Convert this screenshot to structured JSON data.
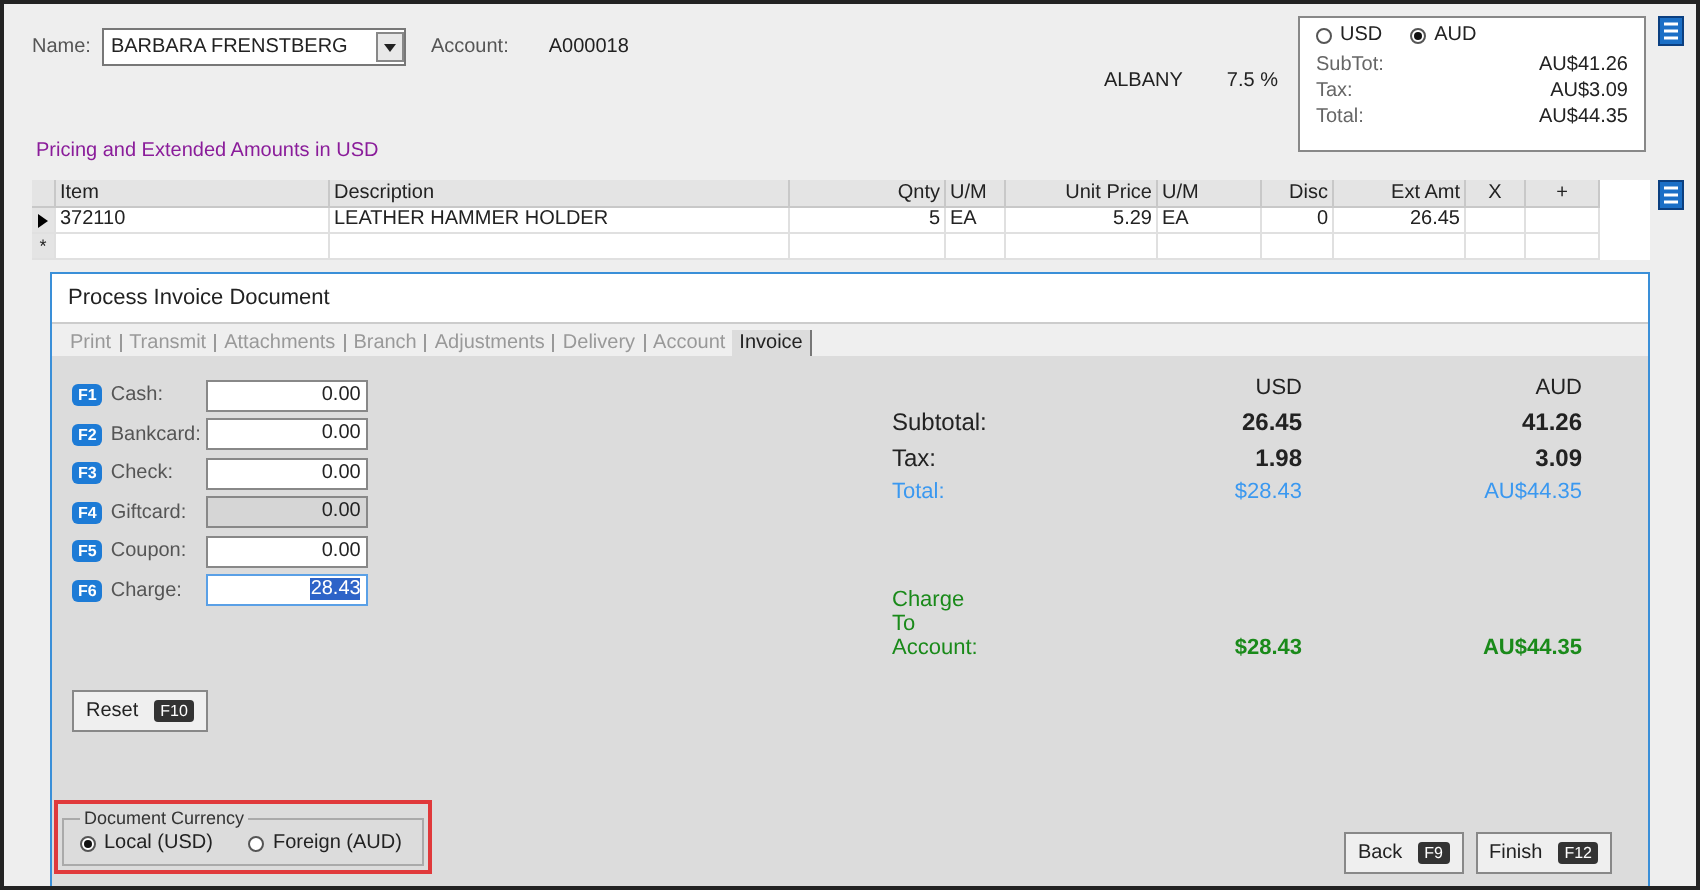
{
  "header": {
    "name_label": "Name:",
    "name_value": "BARBARA FRENSTBERG",
    "account_label": "Account:",
    "account_value": "A000018",
    "branch": "ALBANY",
    "tax_rate": "7.5 %"
  },
  "currency_box": {
    "options": [
      {
        "label": "USD",
        "selected": false
      },
      {
        "label": "AUD",
        "selected": true
      }
    ],
    "rows": [
      {
        "label": "SubTot:",
        "value": "AU$41.26"
      },
      {
        "label": "Tax:",
        "value": "AU$3.09"
      },
      {
        "label": "Total:",
        "value": "AU$44.35"
      }
    ]
  },
  "pricing_note": "Pricing and Extended Amounts in USD",
  "table": {
    "columns": [
      "Item",
      "Description",
      "Qnty",
      "U/M",
      "Unit Price",
      "U/M",
      "Disc",
      "Ext Amt",
      "X",
      "+"
    ],
    "rows": [
      {
        "selected": true,
        "cells": [
          "372110",
          "LEATHER HAMMER HOLDER",
          "5",
          "EA",
          "5.29",
          "EA",
          "0",
          "26.45",
          "",
          ""
        ]
      }
    ],
    "new_row_marker": "*"
  },
  "dialog": {
    "title": "Process Invoice Document",
    "tabs": [
      {
        "label": "Print",
        "selected": false
      },
      {
        "label": "Transmit",
        "selected": false
      },
      {
        "label": "Attachments",
        "selected": false
      },
      {
        "label": "Branch",
        "selected": false
      },
      {
        "label": "Adjustments",
        "selected": false
      },
      {
        "label": "Delivery",
        "selected": false
      },
      {
        "label": "Account",
        "selected": false
      },
      {
        "label": "Invoice",
        "selected": true
      }
    ],
    "payments": [
      {
        "key": "F1",
        "label": "Cash:",
        "value": "0.00",
        "disabled": false,
        "focused": false
      },
      {
        "key": "F2",
        "label": "Bankcard:",
        "value": "0.00",
        "disabled": false,
        "focused": false
      },
      {
        "key": "F3",
        "label": "Check:",
        "value": "0.00",
        "disabled": false,
        "focused": false
      },
      {
        "key": "F4",
        "label": "Giftcard:",
        "value": "0.00",
        "disabled": true,
        "focused": false
      },
      {
        "key": "F5",
        "label": "Coupon:",
        "value": "0.00",
        "disabled": false,
        "focused": false
      },
      {
        "key": "F6",
        "label": "Charge:",
        "value": "28.43",
        "disabled": false,
        "focused": true
      }
    ],
    "summary": {
      "headers": [
        "USD",
        "AUD"
      ],
      "rows": [
        {
          "kind": "plain",
          "label": "Subtotal:",
          "usd": "26.45",
          "aud": "41.26"
        },
        {
          "kind": "plain",
          "label": "Tax:",
          "usd": "1.98",
          "aud": "3.09"
        },
        {
          "kind": "total",
          "label": "Total:",
          "usd": "$28.43",
          "aud": "AU$44.35"
        },
        {
          "kind": "charge",
          "label": "Charge To Account:",
          "usd": "$28.43",
          "aud": "AU$44.35"
        }
      ]
    },
    "reset_button": {
      "label": "Reset",
      "key": "F10"
    },
    "document_currency": {
      "title": "Document Currency",
      "highlighted": true,
      "options": [
        {
          "label": "Local (USD)",
          "selected": true
        },
        {
          "label": "Foreign (AUD)",
          "selected": false
        }
      ]
    },
    "buttons": [
      {
        "label": "Back",
        "key": "F9"
      },
      {
        "label": "Finish",
        "key": "F12"
      }
    ]
  }
}
